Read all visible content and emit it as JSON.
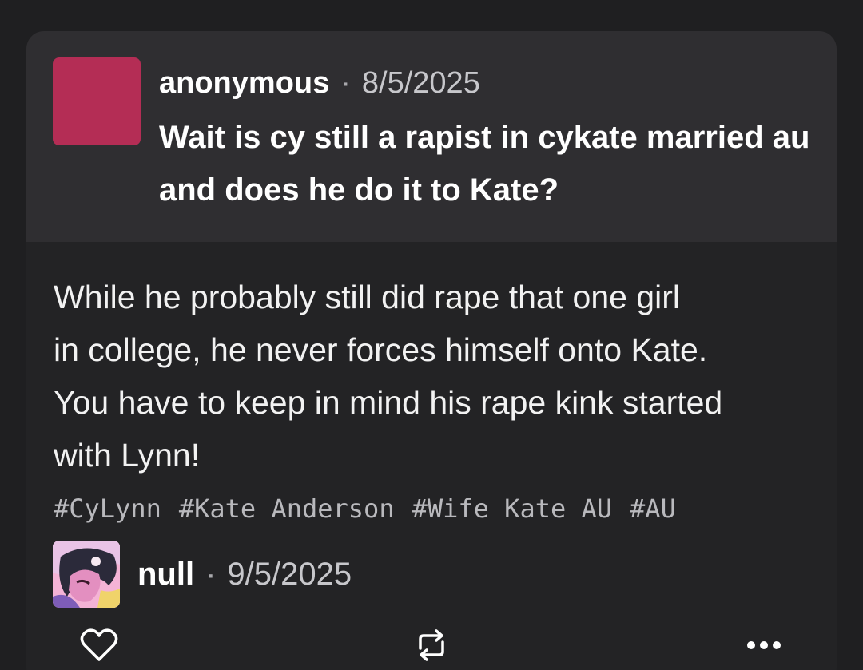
{
  "ask": {
    "name": "anonymous",
    "separator": "·",
    "date": "8/5/2025",
    "question": "Wait is cy still a rapist in cykate married au and does he do it to Kate?"
  },
  "answer": {
    "lines": [
      "While he probably still did rape that one girl",
      "in college, he never forces himself onto Kate.",
      "You have to keep in mind his rape kink started",
      "with Lynn!"
    ]
  },
  "tags": [
    "#CyLynn",
    "#Kate Anderson",
    "#Wife Kate AU",
    "#AU"
  ],
  "reply": {
    "name": "null",
    "separator": "·",
    "date": "9/5/2025"
  },
  "icons": {
    "like": "heart-icon",
    "reblog": "reblog-icon",
    "more": "more-icon"
  },
  "colors": {
    "background": "#1f1f21",
    "card": "#232325",
    "ask_panel": "#2f2e31",
    "anon_avatar": "#b42d55",
    "tag_text": "#b9b9bd"
  }
}
